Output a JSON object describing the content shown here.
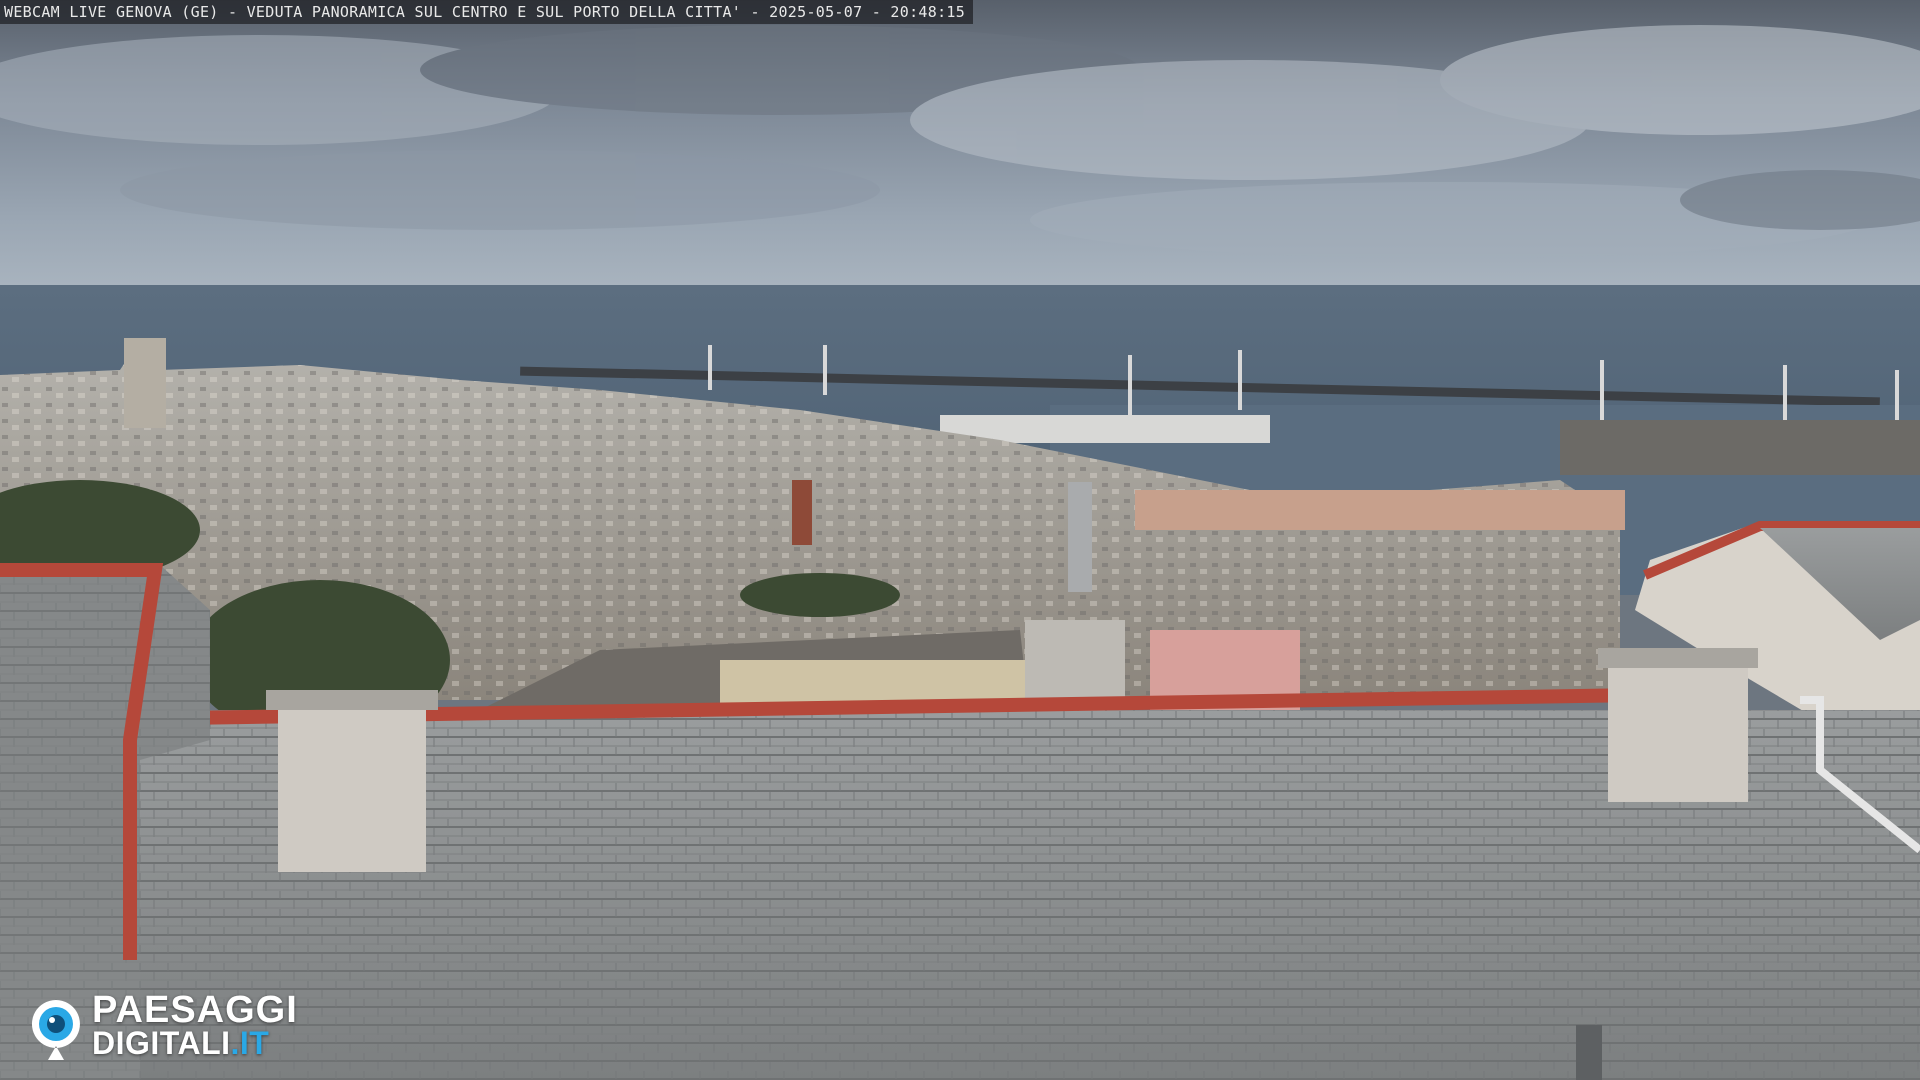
{
  "overlay": {
    "caption": "WEBCAM LIVE GENOVA (GE) - VEDUTA PANORAMICA SUL CENTRO E SUL PORTO DELLA CITTA' - 2025-05-07 - 20:48:15"
  },
  "logo": {
    "line1": "PAESAGGI",
    "line2_main": "DIGITALI",
    "line2_accent": ".IT"
  },
  "colors": {
    "accent": "#2aa8e6",
    "sky": "#8a96a4",
    "sea": "#55687c",
    "roof_slate": "#8f9293",
    "roof_trim": "#b5483a"
  }
}
